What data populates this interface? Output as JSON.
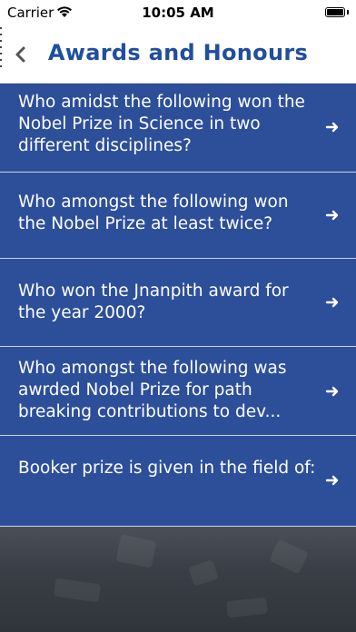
{
  "status_bar": {
    "carrier": "Carrier",
    "time": "10:05 AM",
    "battery_level": 1.0
  },
  "nav": {
    "title": "Awards and Honours",
    "back_icon": "chevron-left-icon"
  },
  "questions": [
    {
      "text": "Who amidst the following won the Nobel Prize in Science in two different disciplines?"
    },
    {
      "text": "Who amongst the following won the Nobel Prize at least twice?"
    },
    {
      "text": "Who won the Jnanpith award for the year 2000?"
    },
    {
      "text": "Who amongst the following was awrded Nobel Prize for path breaking contributions to dev..."
    },
    {
      "text": "Booker prize is given in the field of:"
    }
  ],
  "colors": {
    "accent": "#1f4f9d",
    "list_background": "#2d4f9a"
  },
  "row_icon": "arrow-right-icon"
}
